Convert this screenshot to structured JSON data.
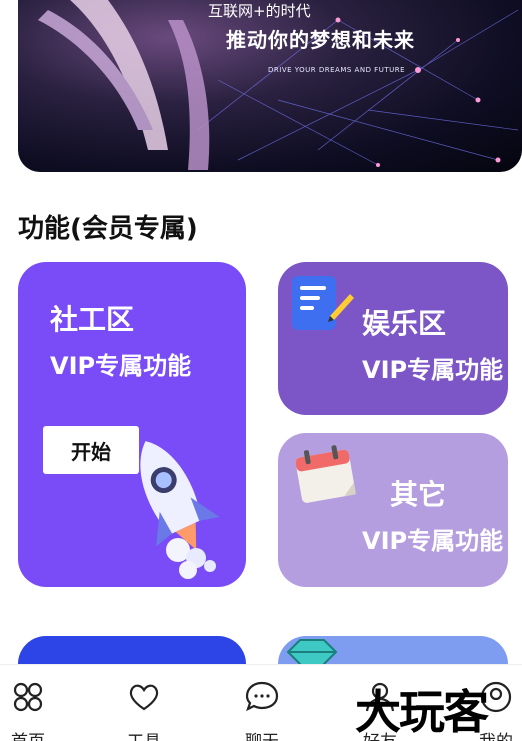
{
  "banner": {
    "line1": "互联网+的时代",
    "line2": "推动你的梦想和未来",
    "line3": "DRIVE YOUR DREAMS AND FUTURE"
  },
  "section": {
    "title": "功能(会员专属)"
  },
  "cards": {
    "social": {
      "title": "社工区",
      "subtitle": "VIP专属功能",
      "button": "开始"
    },
    "entertainment": {
      "title": "娱乐区",
      "subtitle": "VIP专属功能"
    },
    "other": {
      "title": "其它",
      "subtitle": "VIP专属功能"
    }
  },
  "tabbar": {
    "items": [
      {
        "label": "首页",
        "icon": "home-grid-icon"
      },
      {
        "label": "工具",
        "icon": "heart-icon"
      },
      {
        "label": "聊天",
        "icon": "chat-bubble-icon"
      },
      {
        "label": "好友",
        "icon": "friends-icon"
      },
      {
        "label": "我的",
        "icon": "profile-icon"
      }
    ]
  },
  "watermark": "大玩客",
  "colors": {
    "social_card": "#7a4cf8",
    "entertainment_card": "#7c55c6",
    "other_card": "#b49ee0",
    "blue_card": "#2d45e6",
    "lightblue_card": "#7f9df0"
  }
}
